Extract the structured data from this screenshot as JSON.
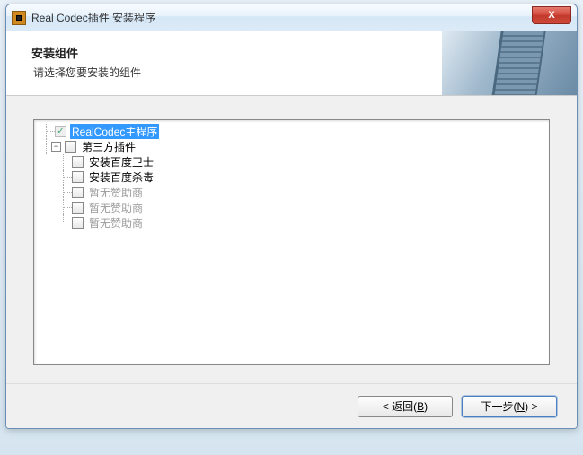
{
  "window": {
    "title": "Real Codec插件 安装程序",
    "close_label": "X"
  },
  "header": {
    "title": "安装组件",
    "subtitle": "请选择您要安装的组件"
  },
  "tree": {
    "root": {
      "label": "RealCodec主程序",
      "checked": true,
      "disabled": true,
      "selected": true
    },
    "group": {
      "label": "第三方插件",
      "expanded": true,
      "children": [
        {
          "label": "安装百度卫士",
          "checked": false,
          "dim": false
        },
        {
          "label": "安装百度杀毒",
          "checked": false,
          "dim": false
        },
        {
          "label": "暂无赞助商",
          "checked": false,
          "dim": true
        },
        {
          "label": "暂无赞助商",
          "checked": false,
          "dim": true
        },
        {
          "label": "暂无赞助商",
          "checked": false,
          "dim": true
        }
      ]
    }
  },
  "footer": {
    "back_prefix": "< 返回(",
    "back_key": "B",
    "back_suffix": ")",
    "next_prefix": "下一步(",
    "next_key": "N",
    "next_suffix": ") >"
  }
}
